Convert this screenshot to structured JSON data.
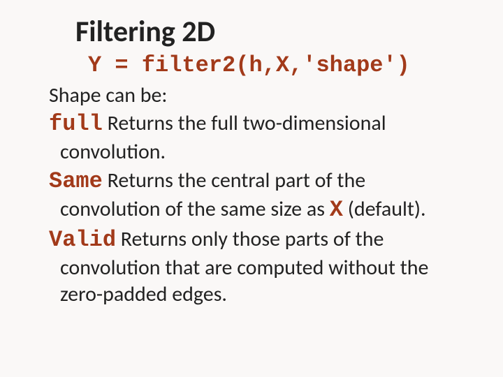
{
  "title": "Filtering 2D",
  "code_line": "Y = filter2(h,X,'shape')",
  "shape_label": "Shape can be:",
  "entries": {
    "full": {
      "kw": "full",
      "l1": " Returns the full two-dimensional",
      "l2": "convolution."
    },
    "same": {
      "kw": "Same",
      "l1": " Returns the central part of the",
      "l2a": "convolution of the same size as ",
      "x": "X",
      "l2b": " (default)."
    },
    "valid": {
      "kw": "Valid",
      "l1": " Returns only those parts of the",
      "l2": "convolution that are computed without the",
      "l3": "zero-padded edges."
    }
  }
}
